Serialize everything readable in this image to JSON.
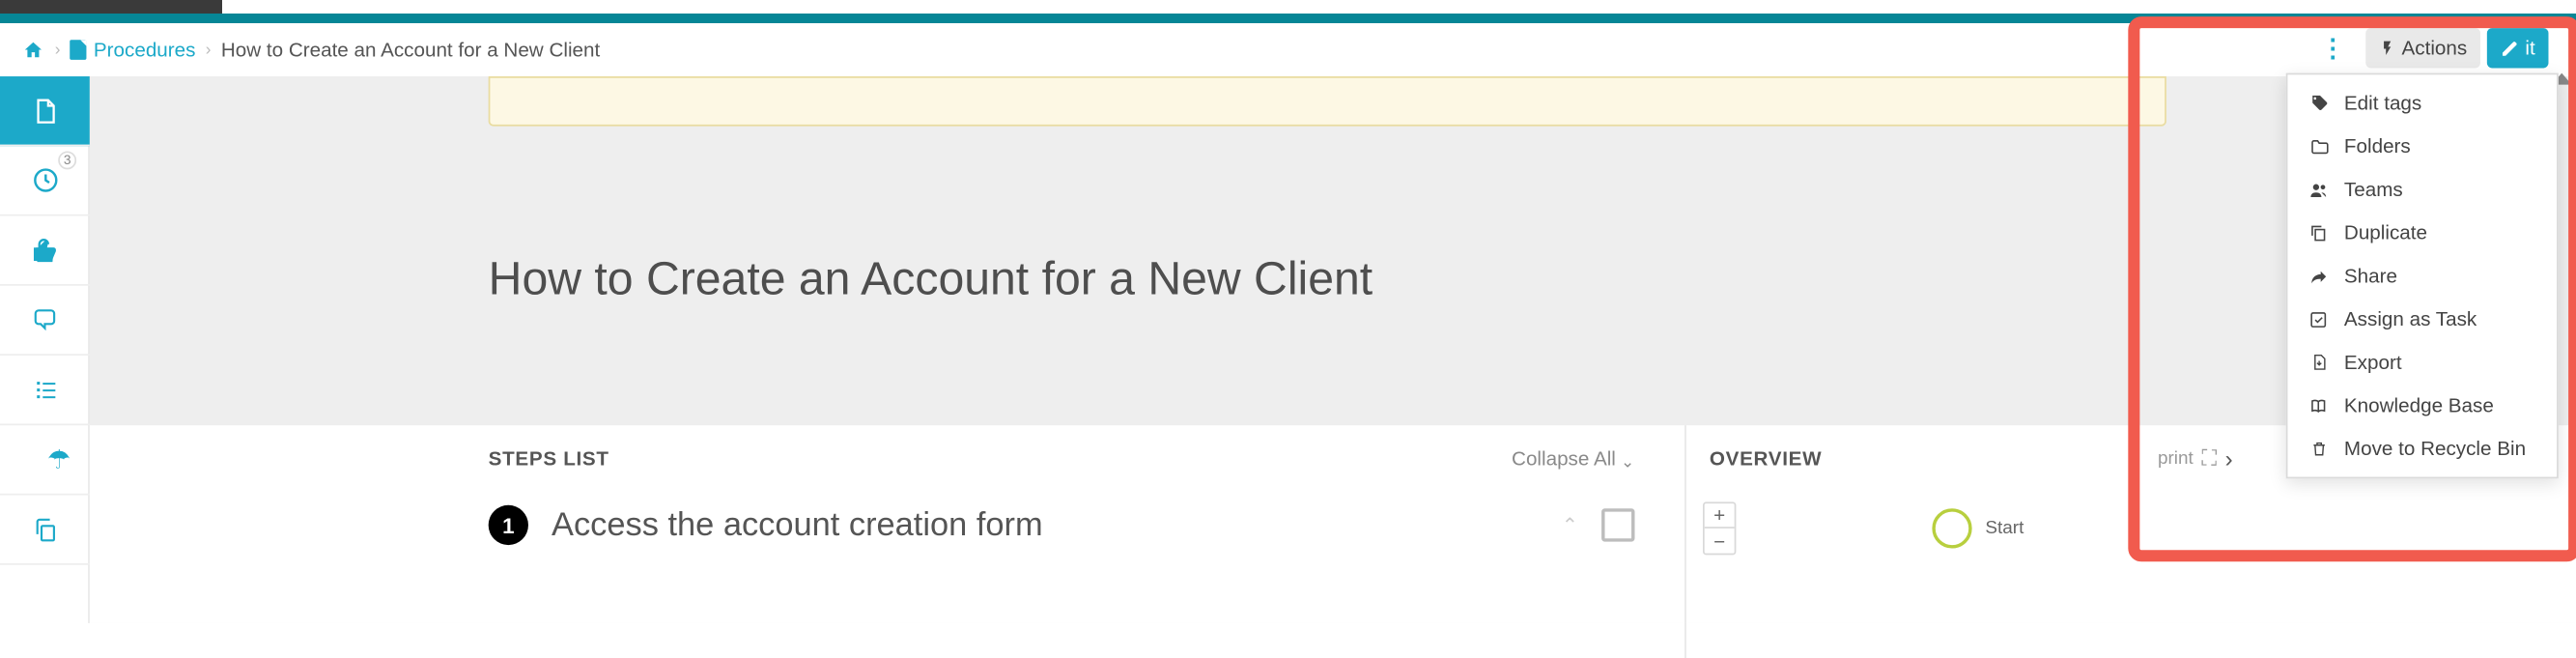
{
  "breadcrumbs": {
    "procedures": "Procedures",
    "title": "How to Create an Account for a New Client"
  },
  "header_buttons": {
    "actions": "Actions",
    "edit": "it"
  },
  "sidebar_badge": "3",
  "page_title": "How to Create an Account for a New Client",
  "start_button": "Start",
  "steps": {
    "header": "STEPS LIST",
    "collapse": "Collapse All",
    "items": [
      {
        "num": "1",
        "title": "Access the account creation form"
      }
    ]
  },
  "overview": {
    "header": "OVERVIEW",
    "print": "print",
    "node_start": "Start"
  },
  "actions_menu": [
    {
      "icon": "tag-icon",
      "label": "Edit tags"
    },
    {
      "icon": "folder-icon",
      "label": "Folders"
    },
    {
      "icon": "teams-icon",
      "label": "Teams"
    },
    {
      "icon": "duplicate-icon",
      "label": "Duplicate"
    },
    {
      "icon": "share-icon",
      "label": "Share"
    },
    {
      "icon": "task-icon",
      "label": "Assign as Task"
    },
    {
      "icon": "export-icon",
      "label": "Export"
    },
    {
      "icon": "book-icon",
      "label": "Knowledge Base"
    },
    {
      "icon": "trash-icon",
      "label": "Move to Recycle Bin"
    }
  ]
}
